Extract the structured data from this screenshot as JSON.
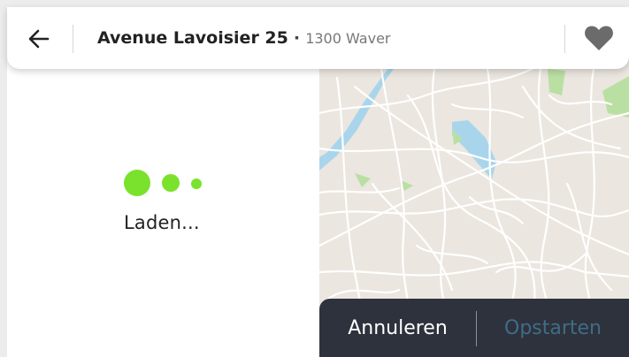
{
  "header": {
    "back_icon": "arrow-left-icon",
    "street": "Avenue Lavoisier 25",
    "separator": "·",
    "city": "1300 Waver",
    "favorite_icon": "heart-icon"
  },
  "loading": {
    "text": "Laden...",
    "dot_color": "#7ae22c"
  },
  "actions": {
    "cancel_label": "Annuleren",
    "start_label": "Opstarten"
  },
  "colors": {
    "actionbar_bg": "#2e323d",
    "start_label_disabled": "#3f6d86",
    "heart": "#6b6b6b",
    "map_land": "#ebe6df",
    "map_water": "#a9d5ec",
    "map_park": "#b9e0a2"
  }
}
